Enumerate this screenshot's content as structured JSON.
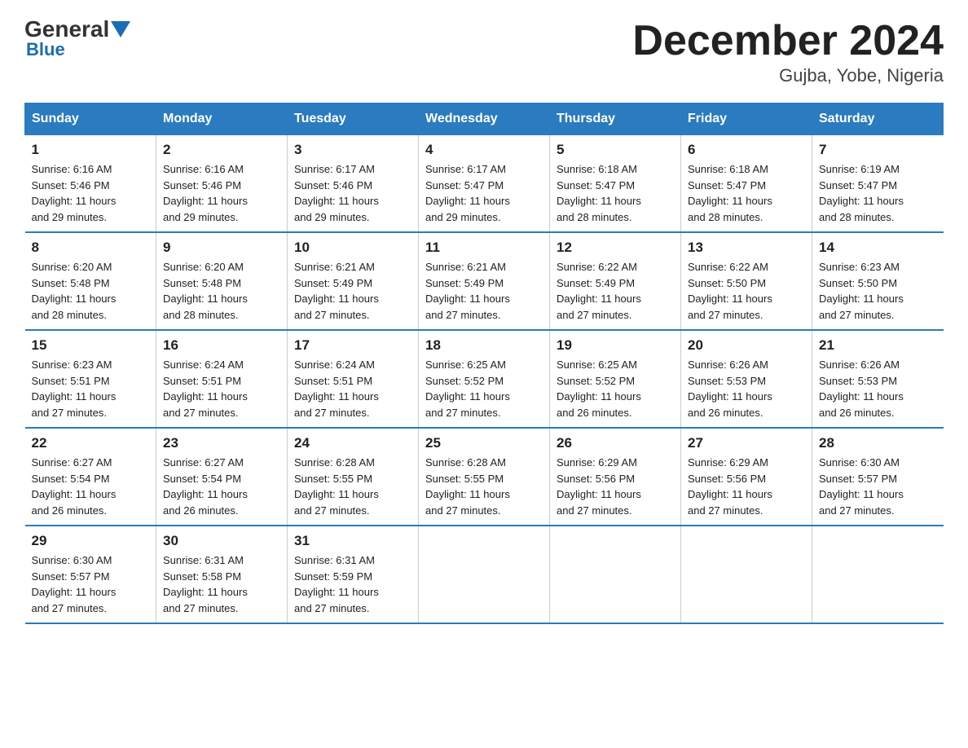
{
  "logo": {
    "general": "General",
    "blue": "Blue"
  },
  "title": "December 2024",
  "subtitle": "Gujba, Yobe, Nigeria",
  "headers": [
    "Sunday",
    "Monday",
    "Tuesday",
    "Wednesday",
    "Thursday",
    "Friday",
    "Saturday"
  ],
  "weeks": [
    [
      {
        "day": "1",
        "sunrise": "6:16 AM",
        "sunset": "5:46 PM",
        "daylight": "11 hours and 29 minutes."
      },
      {
        "day": "2",
        "sunrise": "6:16 AM",
        "sunset": "5:46 PM",
        "daylight": "11 hours and 29 minutes."
      },
      {
        "day": "3",
        "sunrise": "6:17 AM",
        "sunset": "5:46 PM",
        "daylight": "11 hours and 29 minutes."
      },
      {
        "day": "4",
        "sunrise": "6:17 AM",
        "sunset": "5:47 PM",
        "daylight": "11 hours and 29 minutes."
      },
      {
        "day": "5",
        "sunrise": "6:18 AM",
        "sunset": "5:47 PM",
        "daylight": "11 hours and 28 minutes."
      },
      {
        "day": "6",
        "sunrise": "6:18 AM",
        "sunset": "5:47 PM",
        "daylight": "11 hours and 28 minutes."
      },
      {
        "day": "7",
        "sunrise": "6:19 AM",
        "sunset": "5:47 PM",
        "daylight": "11 hours and 28 minutes."
      }
    ],
    [
      {
        "day": "8",
        "sunrise": "6:20 AM",
        "sunset": "5:48 PM",
        "daylight": "11 hours and 28 minutes."
      },
      {
        "day": "9",
        "sunrise": "6:20 AM",
        "sunset": "5:48 PM",
        "daylight": "11 hours and 28 minutes."
      },
      {
        "day": "10",
        "sunrise": "6:21 AM",
        "sunset": "5:49 PM",
        "daylight": "11 hours and 27 minutes."
      },
      {
        "day": "11",
        "sunrise": "6:21 AM",
        "sunset": "5:49 PM",
        "daylight": "11 hours and 27 minutes."
      },
      {
        "day": "12",
        "sunrise": "6:22 AM",
        "sunset": "5:49 PM",
        "daylight": "11 hours and 27 minutes."
      },
      {
        "day": "13",
        "sunrise": "6:22 AM",
        "sunset": "5:50 PM",
        "daylight": "11 hours and 27 minutes."
      },
      {
        "day": "14",
        "sunrise": "6:23 AM",
        "sunset": "5:50 PM",
        "daylight": "11 hours and 27 minutes."
      }
    ],
    [
      {
        "day": "15",
        "sunrise": "6:23 AM",
        "sunset": "5:51 PM",
        "daylight": "11 hours and 27 minutes."
      },
      {
        "day": "16",
        "sunrise": "6:24 AM",
        "sunset": "5:51 PM",
        "daylight": "11 hours and 27 minutes."
      },
      {
        "day": "17",
        "sunrise": "6:24 AM",
        "sunset": "5:51 PM",
        "daylight": "11 hours and 27 minutes."
      },
      {
        "day": "18",
        "sunrise": "6:25 AM",
        "sunset": "5:52 PM",
        "daylight": "11 hours and 27 minutes."
      },
      {
        "day": "19",
        "sunrise": "6:25 AM",
        "sunset": "5:52 PM",
        "daylight": "11 hours and 26 minutes."
      },
      {
        "day": "20",
        "sunrise": "6:26 AM",
        "sunset": "5:53 PM",
        "daylight": "11 hours and 26 minutes."
      },
      {
        "day": "21",
        "sunrise": "6:26 AM",
        "sunset": "5:53 PM",
        "daylight": "11 hours and 26 minutes."
      }
    ],
    [
      {
        "day": "22",
        "sunrise": "6:27 AM",
        "sunset": "5:54 PM",
        "daylight": "11 hours and 26 minutes."
      },
      {
        "day": "23",
        "sunrise": "6:27 AM",
        "sunset": "5:54 PM",
        "daylight": "11 hours and 26 minutes."
      },
      {
        "day": "24",
        "sunrise": "6:28 AM",
        "sunset": "5:55 PM",
        "daylight": "11 hours and 27 minutes."
      },
      {
        "day": "25",
        "sunrise": "6:28 AM",
        "sunset": "5:55 PM",
        "daylight": "11 hours and 27 minutes."
      },
      {
        "day": "26",
        "sunrise": "6:29 AM",
        "sunset": "5:56 PM",
        "daylight": "11 hours and 27 minutes."
      },
      {
        "day": "27",
        "sunrise": "6:29 AM",
        "sunset": "5:56 PM",
        "daylight": "11 hours and 27 minutes."
      },
      {
        "day": "28",
        "sunrise": "6:30 AM",
        "sunset": "5:57 PM",
        "daylight": "11 hours and 27 minutes."
      }
    ],
    [
      {
        "day": "29",
        "sunrise": "6:30 AM",
        "sunset": "5:57 PM",
        "daylight": "11 hours and 27 minutes."
      },
      {
        "day": "30",
        "sunrise": "6:31 AM",
        "sunset": "5:58 PM",
        "daylight": "11 hours and 27 minutes."
      },
      {
        "day": "31",
        "sunrise": "6:31 AM",
        "sunset": "5:59 PM",
        "daylight": "11 hours and 27 minutes."
      },
      null,
      null,
      null,
      null
    ]
  ],
  "labels": {
    "sunrise": "Sunrise: ",
    "sunset": "Sunset: ",
    "daylight": "Daylight: "
  }
}
